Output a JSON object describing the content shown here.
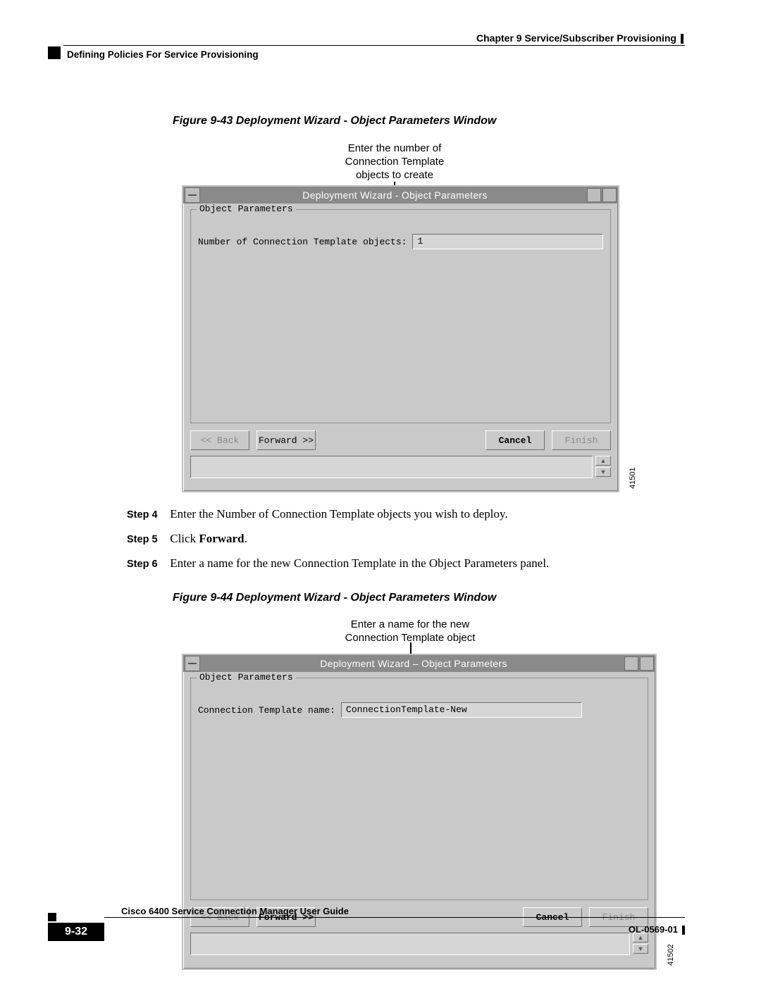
{
  "header": {
    "chapter_ref": "Chapter 9    Service/Subscriber Provisioning",
    "section": "Defining Policies For Service Provisioning"
  },
  "figure43": {
    "caption": "Figure 9-43   Deployment Wizard - Object Parameters Window",
    "callout": "Enter the number of\nConnection Template\nobjects to create",
    "title": "Deployment Wizard - Object Parameters",
    "frame_legend": "Object Parameters",
    "field_label": "Number of Connection Template objects:",
    "field_value": "1",
    "buttons": {
      "back": "<< Back",
      "forward": "Forward >>",
      "cancel": "Cancel",
      "finish": "Finish"
    },
    "id": "41501"
  },
  "figure44": {
    "caption": "Figure 9-44   Deployment Wizard - Object Parameters Window",
    "callout": "Enter a name for the new\nConnection Template object",
    "title": "Deployment Wizard – Object Parameters",
    "frame_legend": "Object Parameters",
    "field_label": "Connection Template name:",
    "field_value": "ConnectionTemplate-New",
    "buttons": {
      "back": "<< Back",
      "forward": "Forward >>",
      "cancel": "Cancel",
      "finish": "Finish"
    },
    "id": "41502"
  },
  "steps": {
    "s4_label": "Step 4",
    "s4_text": "Enter the Number of Connection Template objects you wish to deploy.",
    "s5_label": "Step 5",
    "s5_text_pre": "Click ",
    "s5_text_bold": "Forward",
    "s5_text_post": ".",
    "s6_label": "Step 6",
    "s6_text": "Enter a name for the new Connection Template in the Object Parameters panel."
  },
  "footer": {
    "guide": "Cisco 6400 Service Connection Manager User Guide",
    "page": "9-32",
    "doc": "OL-0569-01"
  }
}
